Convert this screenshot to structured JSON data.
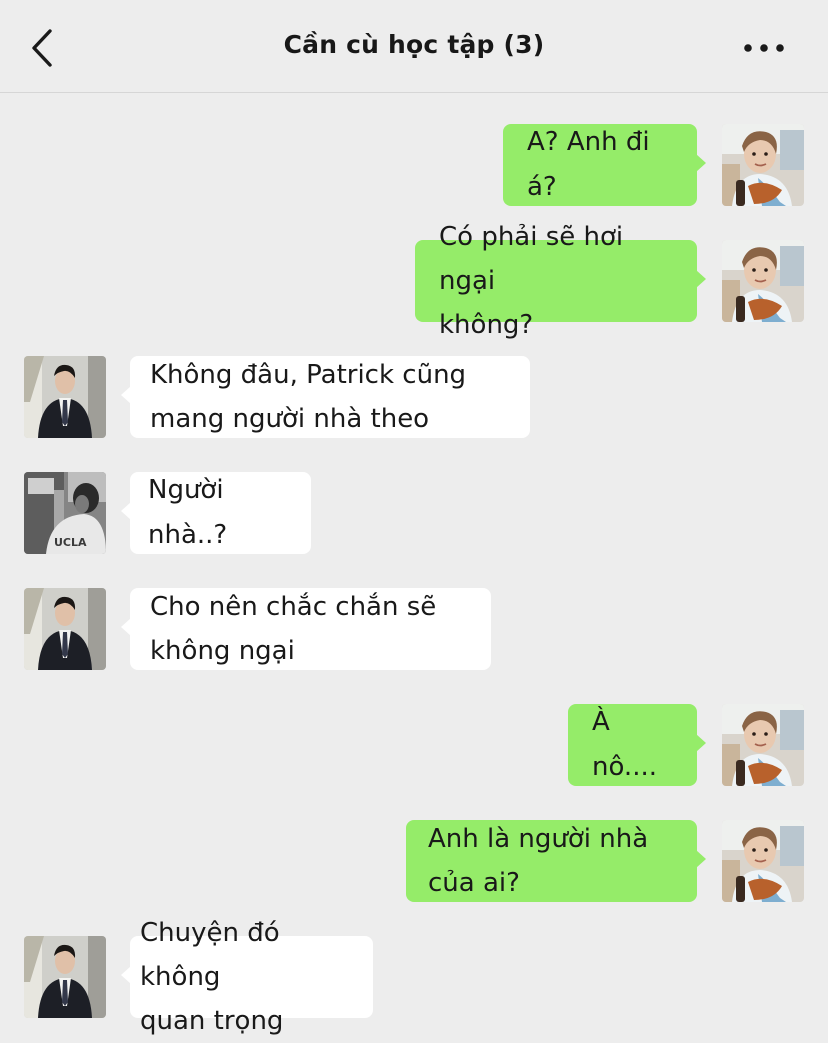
{
  "header": {
    "title": "Cần cù học tập (3)",
    "back_icon": "chevron-left-icon",
    "more_icon": "more-dots-icon"
  },
  "colors": {
    "background": "#ededed",
    "outgoing_bubble": "#95ec69",
    "incoming_bubble": "#ffffff"
  },
  "messages": [
    {
      "side": "right",
      "sender": "self",
      "text": "A? Anh đi á?"
    },
    {
      "side": "right",
      "sender": "self",
      "text": "Có phải sẽ hơi ngại\nkhông?"
    },
    {
      "side": "left",
      "sender": "suit-man",
      "text": "Không đâu, Patrick cũng\nmang người nhà theo"
    },
    {
      "side": "left",
      "sender": "bw-photo",
      "text": "Người nhà..?"
    },
    {
      "side": "left",
      "sender": "suit-man",
      "text": "Cho nên chắc chắn sẽ\nkhông ngại"
    },
    {
      "side": "right",
      "sender": "self",
      "text": "À nô...."
    },
    {
      "side": "right",
      "sender": "self",
      "text": "Anh là người nhà\ncủa ai?"
    },
    {
      "side": "left",
      "sender": "suit-man",
      "text": "Chuyện đó không\nquan trọng"
    }
  ]
}
